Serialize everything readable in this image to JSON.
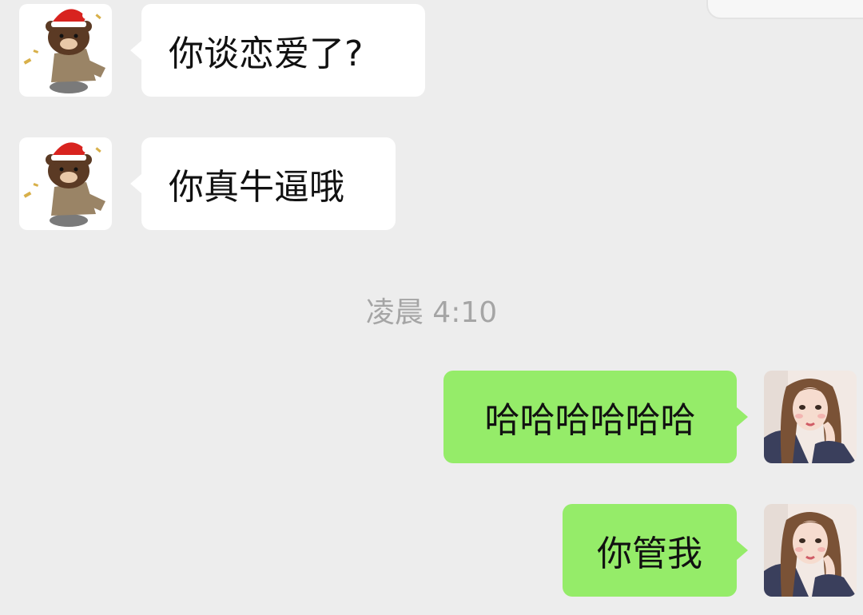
{
  "chat": {
    "incoming": [
      {
        "text": "你谈恋爱了?",
        "avatar": "brown-bear-santa-hat-sticker"
      },
      {
        "text": "你真牛逼哦",
        "avatar": "brown-bear-santa-hat-sticker"
      }
    ],
    "timestamp": "凌晨 4:10",
    "outgoing": [
      {
        "text": "哈哈哈哈哈哈",
        "avatar": "illustrated-girl-portrait"
      },
      {
        "text": "你管我",
        "avatar": "illustrated-girl-portrait"
      }
    ]
  },
  "colors": {
    "background": "#ededed",
    "incoming_bubble": "#ffffff",
    "outgoing_bubble": "#95ec69",
    "timestamp_text": "#a5a5a5"
  }
}
